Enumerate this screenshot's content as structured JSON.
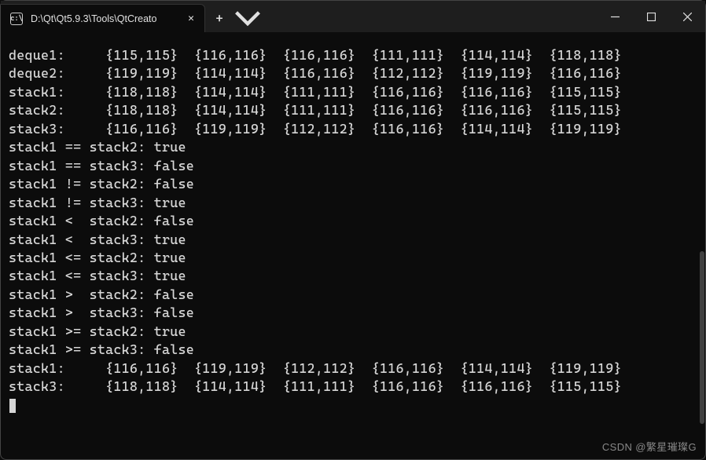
{
  "titlebar": {
    "tab_title": "D:\\Qt\\Qt5.9.3\\Tools\\QtCreato",
    "cmd_glyph": "c:\\"
  },
  "data_rows": [
    {
      "label": "deque1:",
      "vals": [
        "{115,115}",
        "{116,116}",
        "{116,116}",
        "{111,111}",
        "{114,114}",
        "{118,118}"
      ]
    },
    {
      "label": "deque2:",
      "vals": [
        "{119,119}",
        "{114,114}",
        "{116,116}",
        "{112,112}",
        "{119,119}",
        "{116,116}"
      ]
    },
    {
      "label": "stack1:",
      "vals": [
        "{118,118}",
        "{114,114}",
        "{111,111}",
        "{116,116}",
        "{116,116}",
        "{115,115}"
      ]
    },
    {
      "label": "stack2:",
      "vals": [
        "{118,118}",
        "{114,114}",
        "{111,111}",
        "{116,116}",
        "{116,116}",
        "{115,115}"
      ]
    },
    {
      "label": "stack3:",
      "vals": [
        "{116,116}",
        "{119,119}",
        "{112,112}",
        "{116,116}",
        "{114,114}",
        "{119,119}"
      ]
    }
  ],
  "cmp_rows": [
    {
      "text": "stack1 == stack2: true"
    },
    {
      "text": "stack1 == stack3: false"
    },
    {
      "text": "stack1 != stack2: false"
    },
    {
      "text": "stack1 != stack3: true"
    },
    {
      "text": "stack1 <  stack2: false"
    },
    {
      "text": "stack1 <  stack3: true"
    },
    {
      "text": "stack1 <= stack2: true"
    },
    {
      "text": "stack1 <= stack3: true"
    },
    {
      "text": "stack1 >  stack2: false"
    },
    {
      "text": "stack1 >  stack3: false"
    },
    {
      "text": "stack1 >= stack2: true"
    },
    {
      "text": "stack1 >= stack3: false"
    }
  ],
  "final_rows": [
    {
      "label": "stack1:",
      "vals": [
        "{116,116}",
        "{119,119}",
        "{112,112}",
        "{116,116}",
        "{114,114}",
        "{119,119}"
      ]
    },
    {
      "label": "stack3:",
      "vals": [
        "{118,118}",
        "{114,114}",
        "{111,111}",
        "{116,116}",
        "{116,116}",
        "{115,115}"
      ]
    }
  ],
  "watermark": "CSDN @繁星璀璨G"
}
